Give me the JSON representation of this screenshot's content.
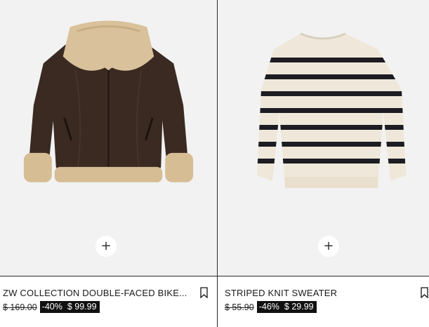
{
  "products": [
    {
      "name": "ZW COLLECTION DOUBLE-FACED BIKE...",
      "old_price": "$ 169.00",
      "discount": "-40%",
      "price": "$ 99.99",
      "add_label": "+",
      "image_icon": "shearling-jacket-image"
    },
    {
      "name": "STRIPED KNIT SWEATER",
      "old_price": "$ 55.90",
      "discount": "-46%",
      "price": "$ 29.99",
      "add_label": "+",
      "image_icon": "striped-sweater-image"
    }
  ],
  "icons": {
    "add": "plus-icon",
    "save": "bookmark-icon"
  },
  "colors": {
    "image_background": "#f2f2f2",
    "price_tag_background": "#111111",
    "price_tag_text": "#ffffff"
  }
}
